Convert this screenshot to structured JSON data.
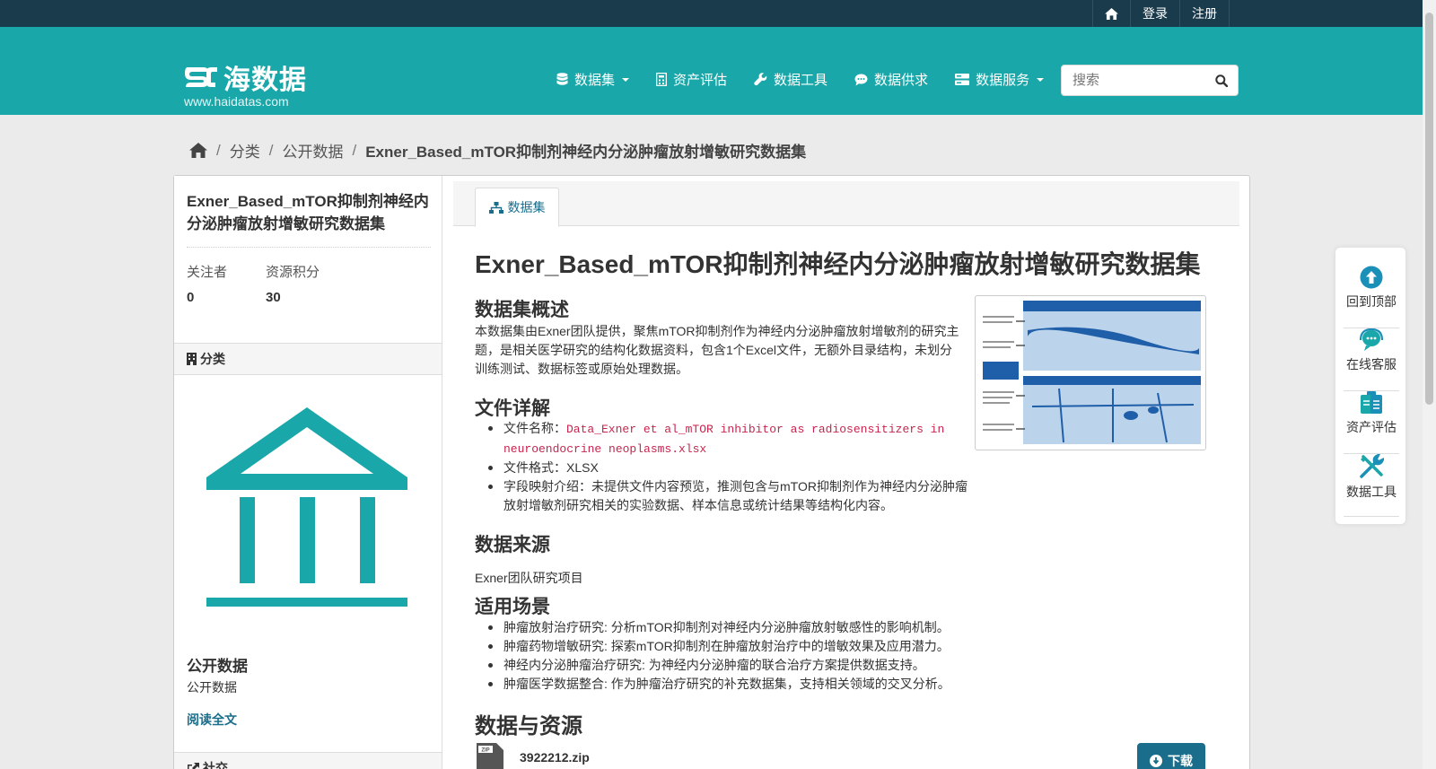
{
  "topbar": {
    "links": [
      "登录",
      "注册"
    ]
  },
  "logo": {
    "text": "海数据",
    "url": "www.haidatas.com"
  },
  "nav": {
    "items": [
      "数据集",
      "资产评估",
      "数据工具",
      "数据供求",
      "数据服务"
    ]
  },
  "search": {
    "placeholder": "搜索"
  },
  "breadcrumb": {
    "items": [
      "分类",
      "公开数据"
    ],
    "current": "Exner_Based_mTOR抑制剂神经内分泌肿瘤放射增敏研究数据集"
  },
  "sidebar": {
    "title": "Exner_Based_mTOR抑制剂神经内分泌肿瘤放射增敏研究数据集",
    "stats": [
      {
        "label": "关注者",
        "value": "0"
      },
      {
        "label": "资源积分",
        "value": "30"
      }
    ],
    "category_heading": "分类",
    "org_title": "公开数据",
    "org_desc": "公开数据",
    "read_more": "阅读全文",
    "social_heading": "社交"
  },
  "main": {
    "tab": "数据集",
    "title": "Exner_Based_mTOR抑制剂神经内分泌肿瘤放射增敏研究数据集",
    "overview_heading": "数据集概述",
    "overview": "本数据集由Exner团队提供，聚焦mTOR抑制剂作为神经内分泌肿瘤放射增敏剂的研究主题，是相关医学研究的结构化数据资料，包含1个Excel文件，无额外目录结构，未划分训练测试、数据标签或原始处理数据。",
    "file_heading": "文件详解",
    "file_name_label": "文件名称：",
    "file_name": "Data_Exner et al_mTOR inhibitor as radiosensitizers in neuroendocrine neoplasms.xlsx",
    "file_format": "文件格式：XLSX",
    "field_intro": "字段映射介绍：未提供文件内容预览，推测包含与mTOR抑制剂作为神经内分泌肿瘤放射增敏剂研究相关的实验数据、样本信息或统计结果等结构化内容。",
    "source_heading": "数据来源",
    "source": "Exner团队研究项目",
    "scenario_heading": "适用场景",
    "scenarios": [
      "肿瘤放射治疗研究: 分析mTOR抑制剂对神经内分泌肿瘤放射敏感性的影响机制。",
      "肿瘤药物增敏研究: 探索mTOR抑制剂在肿瘤放射治疗中的增敏效果及应用潜力。",
      "神经内分泌肿瘤治疗研究: 为神经内分泌肿瘤的联合治疗方案提供数据支持。",
      "肿瘤医学数据整合: 作为肿瘤治疗研究的补充数据集，支持相关领域的交叉分析。"
    ],
    "resources_heading": "数据与资源",
    "resource_name": "3922212.zip",
    "resource_badge": "ZIP",
    "download": "下载"
  },
  "float_tools": [
    "回到顶部",
    "在线客服",
    "资产评估",
    "数据工具"
  ],
  "colors": {
    "brand": "#1aa7a9",
    "topbar": "#1a3b4c",
    "link": "#1a6e8c"
  }
}
